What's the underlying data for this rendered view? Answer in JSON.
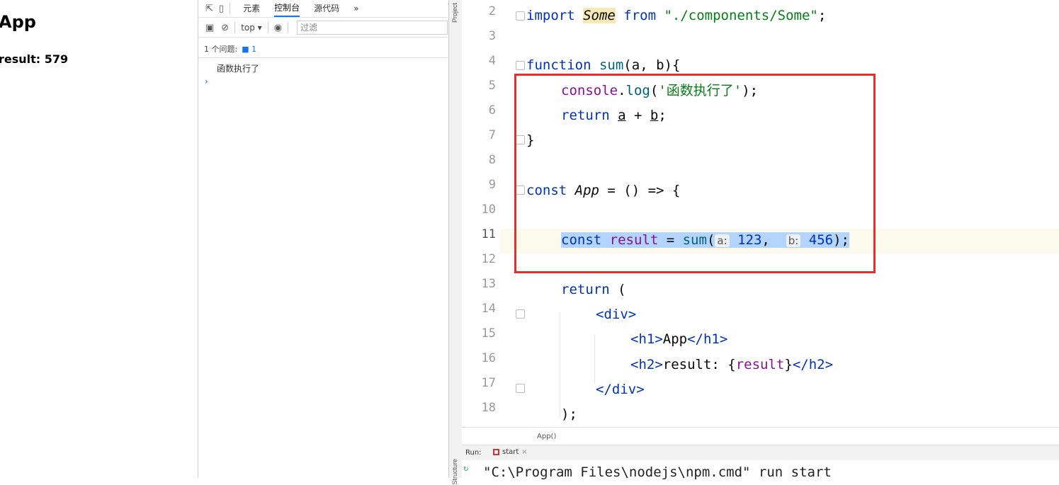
{
  "page": {
    "heading": "App",
    "result": "result: 579"
  },
  "devtools": {
    "tabs": [
      "元素",
      "控制台",
      "源代码",
      "»"
    ],
    "active_tab": "控制台",
    "context": "top ▾",
    "filter_placeholder": "过滤",
    "issues_label": "1 个问题:",
    "issues_count": "1",
    "log_message": "函数执行了",
    "prompt": "›"
  },
  "ide": {
    "side_label_top": "Project",
    "side_label_bottom": "Structure",
    "line_numbers": [
      "2",
      "3",
      "4",
      "5",
      "6",
      "7",
      "8",
      "9",
      "10",
      "11",
      "12",
      "13",
      "14",
      "15",
      "16",
      "17",
      "18"
    ],
    "code": {
      "l2_import": "import ",
      "l2_some": "Some",
      "l2_from": " from ",
      "l2_path": "\"./components/Some\"",
      "l2_end": ";",
      "l4_function": "function ",
      "l4_sum": "sum",
      "l4_params_open": "(",
      "l4_a": "a",
      "l4_comma": ", ",
      "l4_b": "b",
      "l4_params_close": "){",
      "l5_console": "console",
      "l5_dot": ".",
      "l5_log": "log",
      "l5_open": "(",
      "l5_str": "'函数执行了'",
      "l5_close": ");",
      "l6_return": "return ",
      "l6_a": "a",
      "l6_plus": " + ",
      "l6_b": "b",
      "l6_end": ";",
      "l7": "}",
      "l9_const": "const ",
      "l9_app": "App",
      "l9_rest": " = () => {",
      "l11_const": "const ",
      "l11_result": "result",
      "l11_eq": " = ",
      "l11_sum": "sum",
      "l11_open": "(",
      "l11_hint_a": "a:",
      "l11_val_a": "123",
      "l11_comma": ",  ",
      "l11_hint_b": "b:",
      "l11_val_b": "456",
      "l11_close": ");",
      "l13_return": "return ",
      "l13_paren": "(",
      "l14_div": "<div>",
      "l15_open": "<h1>",
      "l15_text": "App",
      "l15_close": "</h1>",
      "l16_open": "<h2>",
      "l16_text": "result: {",
      "l16_var": "result",
      "l16_brace": "}",
      "l16_close": "</h2>",
      "l17_div": "</div>",
      "l18": ");"
    },
    "breadcrumb": "App()",
    "run_label": "Run:",
    "run_tab": "start",
    "run_tab_close": "×",
    "run_output": "\"C:\\Program Files\\nodejs\\npm.cmd\" run start"
  },
  "colors": {
    "highlight_box": "#e0312e",
    "selection": "#b3d4fc",
    "keyword": "#0033b3",
    "string": "#067d17"
  }
}
